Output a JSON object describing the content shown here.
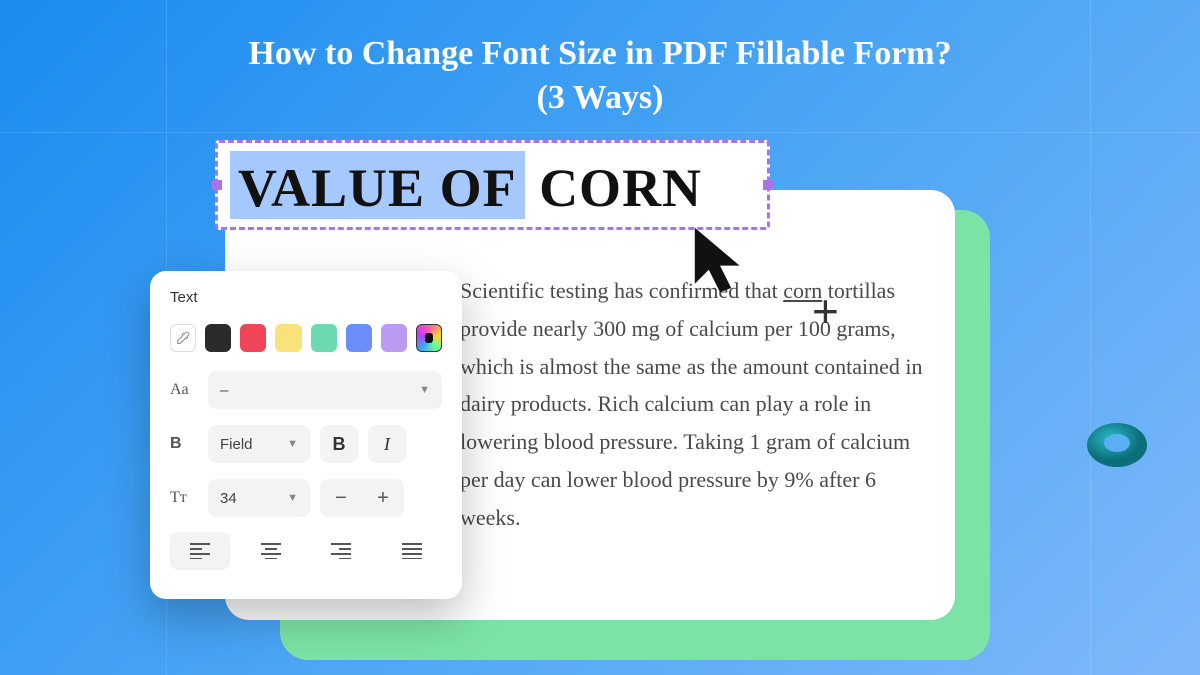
{
  "title": {
    "line1": "How to Change Font Size in PDF Fillable Form?",
    "line2": "(3 Ways)"
  },
  "editor": {
    "heading_highlighted": "VALUE OF",
    "heading_rest": " CORN",
    "body": "Scientific testing has confirmed that corn tortillas provide nearly 300 mg of calcium per 100 grams, which is almost the same as the amount contained in dairy products. Rich calcium can play a role in lowering blood pressure. Taking 1 gram of calcium per day can lower blood pressure by 9% after 6 weeks.",
    "underlined_word": "corn"
  },
  "text_panel": {
    "title": "Text",
    "colors": [
      "eyedropper",
      "black",
      "red",
      "yellow",
      "teal",
      "blue",
      "purple",
      "picker"
    ],
    "font_family_row": {
      "icon": "Aa",
      "value": "–"
    },
    "style_row": {
      "icon": "B",
      "value": "Field",
      "bold_label": "B",
      "italic_label": "I"
    },
    "size_row": {
      "icon": "Tт",
      "value": "34",
      "minus": "−",
      "plus": "+"
    },
    "alignments": [
      "left",
      "center",
      "right",
      "justify"
    ],
    "active_alignment": "left"
  }
}
